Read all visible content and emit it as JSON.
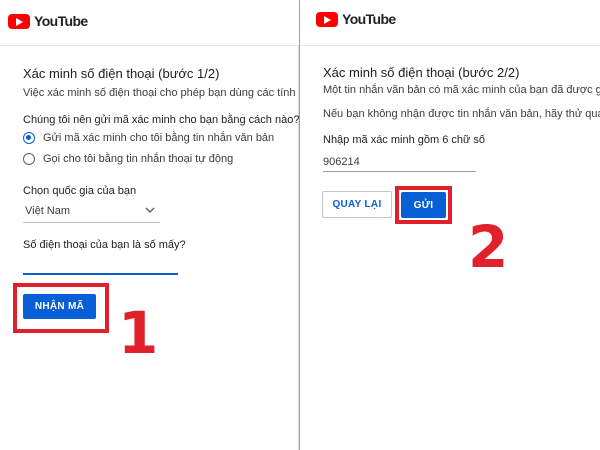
{
  "brand": {
    "name": "YouTube",
    "accent": "#065fd4",
    "logo_red": "#ff0000",
    "highlight": "#e0202a"
  },
  "step1": {
    "title": "Xác minh số điện thoại (bước 1/2)",
    "description": "Việc xác minh số điện thoại cho phép bạn dùng các tính nă",
    "method_question": "Chúng tôi nên gửi mã xác minh cho bạn bằng cách nào?",
    "options": [
      {
        "label": "Gửi mã xác minh cho tôi bằng tin nhắn văn bản",
        "selected": true
      },
      {
        "label": "Gọi cho tôi bằng tin nhắn thoại tự động",
        "selected": false
      }
    ],
    "country_label": "Chọn quốc gia của bạn",
    "country_value": "Việt Nam",
    "phone_label": "Số điện thoại của bạn là số mấy?",
    "phone_value": "",
    "submit_label": "NHẬN MÃ",
    "step_number": "1"
  },
  "step2": {
    "title": "Xác minh số điện thoại (bước 2/2)",
    "description": "Một tin nhắn văn bản có mã xác minh của bạn đã được gửi",
    "hint": "Nếu bạn không nhận được tin nhắn văn bản, hãy thử quay lạ",
    "code_label": "Nhập mã xác minh gồm 6 chữ số",
    "code_value": "906214",
    "back_label": "QUAY LẠI",
    "submit_label": "GỬI",
    "step_number": "2"
  }
}
